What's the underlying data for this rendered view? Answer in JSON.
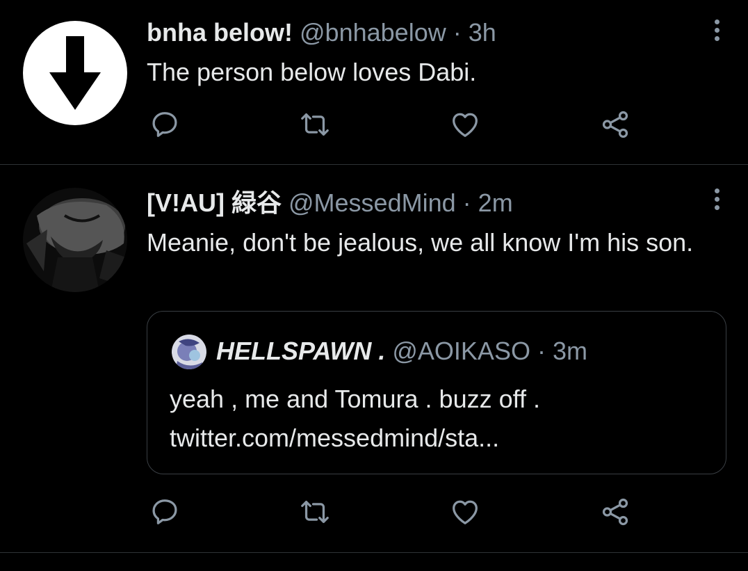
{
  "tweets": [
    {
      "name": "bnha below!",
      "handle": "@bnhabelow",
      "separator": "·",
      "time": "3h",
      "text": "The person below loves Dabi.",
      "avatar_icon": "down-arrow-icon"
    },
    {
      "name": "[V!AU] 緑谷",
      "handle": "@MessedMind",
      "separator": "·",
      "time": "2m",
      "text": "Meanie, don't be jealous, we all know I'm his son.",
      "quote": {
        "name": "HELLSPAWN .",
        "handle": "@AOIKASO",
        "separator": "·",
        "time": "3m",
        "text_line1": "yeah , me and Tomura . buzz off .",
        "text_line2": "twitter.com/messedmind/sta..."
      }
    }
  ],
  "action_icons": [
    "reply-icon",
    "retweet-icon",
    "like-icon",
    "share-icon"
  ],
  "colors": {
    "background": "#000000",
    "text": "#e7e9ea",
    "secondary": "#8b98a5",
    "divider": "#2f3336"
  }
}
